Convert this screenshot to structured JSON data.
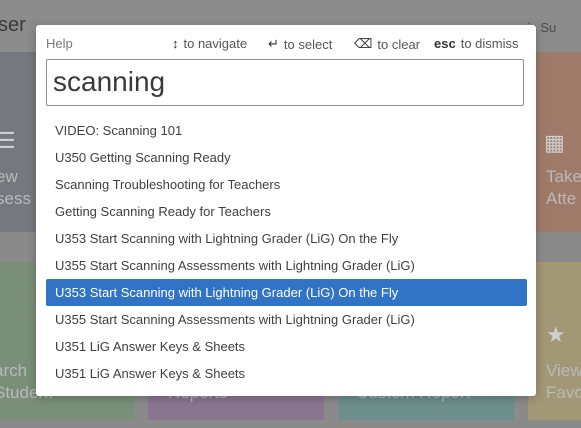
{
  "background": {
    "title_fragment": "ser",
    "today_fragment": "ay is Su",
    "tiles": {
      "gray_text": "ew\nsess",
      "orange_text": "Take\nAtte",
      "green_text": "arch\nStudent",
      "purple_text": "Reports",
      "teal_text": "Custom Report",
      "yellow_text": "View\nFavo"
    }
  },
  "help": {
    "label": "Help",
    "hints": {
      "navigate_key": "↕",
      "navigate_text": "to navigate",
      "select_key": "↵",
      "select_text": "to select",
      "clear_key": "⌫",
      "clear_text": "to clear",
      "dismiss_key": "esc",
      "dismiss_text": "to dismiss"
    },
    "query": "scanning",
    "results": [
      "VIDEO: Scanning 101",
      "U350 Getting Scanning Ready",
      "Scanning Troubleshooting for Teachers",
      "Getting Scanning Ready for Teachers",
      "U353 Start Scanning with Lightning Grader (LiG) On the Fly",
      "U355 Start Scanning Assessments with Lightning Grader (LiG)",
      "U353 Start Scanning with Lightning Grader (LiG) On the Fly",
      "U355 Start Scanning Assessments with Lightning Grader (LiG)",
      "U351 LiG Answer Keys & Sheets",
      "U351 LiG Answer Keys & Sheets"
    ],
    "selected_index": 6
  },
  "colors": {
    "selection": "#3173c4",
    "overlay": "#8a8a8a"
  }
}
